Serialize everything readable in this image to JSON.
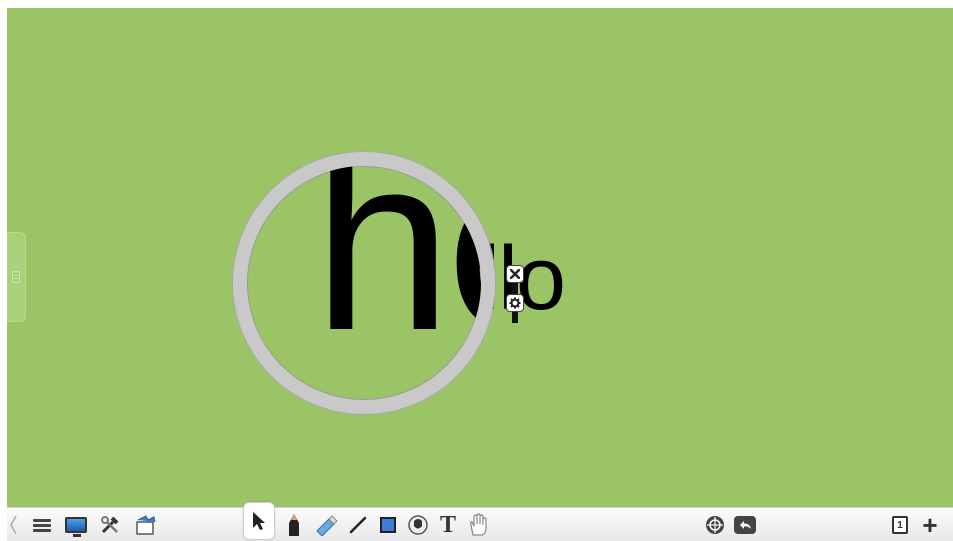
{
  "canvas": {
    "background": "#9bc467",
    "text_object": "llo",
    "magnified_text": "he"
  },
  "object_controls": {
    "close_icon": "close-icon",
    "settings_icon": "gear-icon"
  },
  "side_panel": {
    "icon": "grip-icon"
  },
  "toolbar": {
    "left": [
      {
        "name": "collapse-chevron-icon"
      },
      {
        "name": "menu-icon"
      },
      {
        "name": "display-icon"
      },
      {
        "name": "tools-icon"
      },
      {
        "name": "gallery-icon"
      }
    ],
    "tools": [
      {
        "name": "select-tool-icon",
        "active": true
      },
      {
        "name": "pen-tool-icon"
      },
      {
        "name": "highlighter-tool-icon"
      },
      {
        "name": "line-tool-icon"
      },
      {
        "name": "shape-tool-icon"
      },
      {
        "name": "fill-tool-icon"
      },
      {
        "name": "text-tool-icon",
        "label": "T"
      },
      {
        "name": "pan-tool-icon"
      }
    ],
    "center": [
      {
        "name": "target-icon"
      },
      {
        "name": "undo-icon"
      }
    ],
    "right": {
      "page_number": "1",
      "add_page_label": "+"
    }
  }
}
